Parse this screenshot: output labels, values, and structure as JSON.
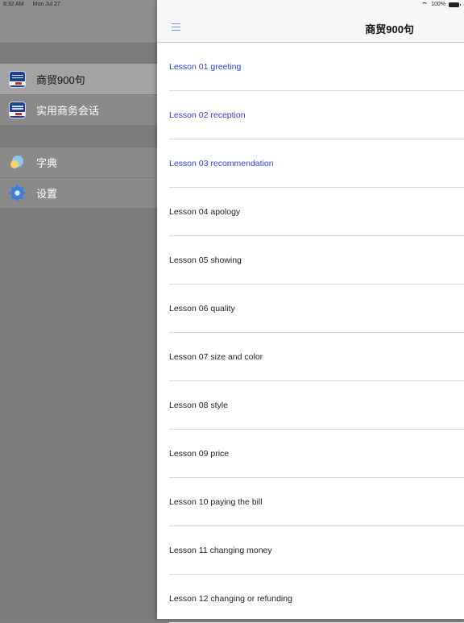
{
  "status_bar": {
    "time": "8:32 AM",
    "date": "Mon Jul 27",
    "battery": "100%"
  },
  "nav": {
    "title": "商贸900句"
  },
  "sidebar": {
    "group1": [
      {
        "label": "商贸900句",
        "icon": "app-icon",
        "selected": true
      },
      {
        "label": "实用商务会话",
        "icon": "app-icon",
        "selected": false
      }
    ],
    "group2": [
      {
        "label": "字典",
        "icon": "dictionary-icon"
      },
      {
        "label": "设置",
        "icon": "gear-icon"
      }
    ]
  },
  "lessons": [
    "Lesson 01 greeting",
    "Lesson 02 reception",
    "Lesson 03 recommendation",
    "Lesson 04 apology",
    "Lesson 05 showing",
    "Lesson 06 quality",
    "Lesson 07 size and color",
    "Lesson 08 style",
    "Lesson 09 price",
    "Lesson 10 paying the bill",
    "Lesson 11 changing money",
    "Lesson 12 changing or refunding"
  ],
  "colors": {
    "link": "#3a3ae0",
    "text": "#222222",
    "accent": "#6f94d0"
  }
}
